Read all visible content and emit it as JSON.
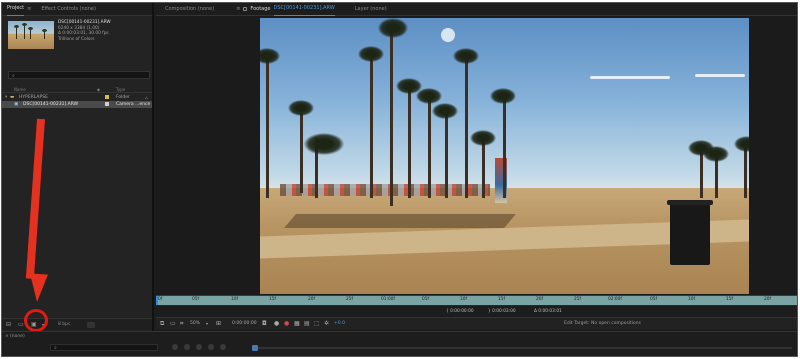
{
  "project_panel": {
    "tabs": [
      {
        "label": "Project",
        "active": true
      },
      {
        "label": "Effect Controls (none)",
        "active": false
      }
    ],
    "selected_item": {
      "name": "DSC[00141-00231].ARW",
      "dimensions": "6240 x 3384 (1.00)",
      "duration": "Δ 0:00:03:01, 30.00 fps",
      "colors": "Trillions of Colors"
    },
    "search_placeholder": "",
    "columns": {
      "name": "Name",
      "label": "",
      "type": "Type"
    },
    "items": [
      {
        "name": "HYPERLAPSE",
        "type": "Folder",
        "label_color": "#d7b94a",
        "selected": false
      },
      {
        "name": "DSC[00141-00231].ARW",
        "type": "Camera ...ence",
        "label_color": "#cfcfcf",
        "selected": true
      }
    ],
    "bpc": "8 bpc"
  },
  "viewer_panel": {
    "tabs": [
      {
        "label": "Composition (none)",
        "active": false
      },
      {
        "label": "Footage",
        "active": true,
        "file": "DSC[00141-00231].ARW"
      },
      {
        "label": "Layer (none)",
        "active": false
      }
    ]
  },
  "ruler": {
    "ticks": [
      "0f",
      "05f",
      "10f",
      "15f",
      "20f",
      "25f",
      "01:00f",
      "05f",
      "10f",
      "15f",
      "20f",
      "25f",
      "02:00f",
      "05f",
      "10f",
      "15f",
      "20f"
    ]
  },
  "in_out": {
    "in": "{ 0:00:00:00",
    "out": "} 0:00:03:00",
    "duration": "Δ 0:00:03:01"
  },
  "viewer_controls": {
    "zoom": "50%",
    "timecode": "0:00:00:00",
    "exposure": "+0.0",
    "edit_target": "Edit Target: No open compositions"
  },
  "timeline": {
    "comp_name": "(none)",
    "close_symbol": "×",
    "search_placeholder": ""
  },
  "icons": {
    "search": "search-icon",
    "interpret_footage": "interpret-footage-icon",
    "new_folder": "new-folder-icon",
    "new_composition": "new-composition-icon",
    "trash": "trash-icon"
  },
  "annotation_color": "#e11b13"
}
